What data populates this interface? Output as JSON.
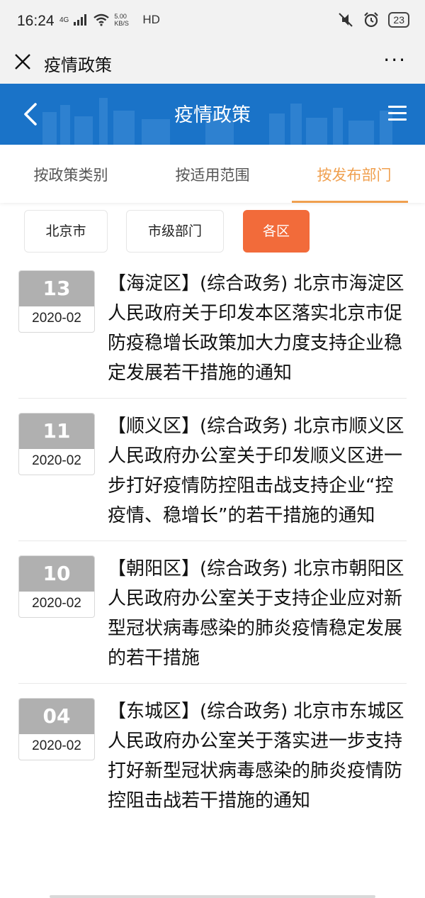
{
  "status_bar": {
    "time": "16:24",
    "network": "4G",
    "speed": "5.00 KB/S",
    "hd": "HD",
    "battery": "23"
  },
  "wechat_bar": {
    "title": "疫情政策",
    "more": "···"
  },
  "header": {
    "title": "疫情政策"
  },
  "tabs": [
    {
      "label": "按政策类别",
      "active": false
    },
    {
      "label": "按适用范围",
      "active": false
    },
    {
      "label": "按发布部门",
      "active": true
    }
  ],
  "filters": [
    {
      "label": "北京市",
      "active": false
    },
    {
      "label": "市级部门",
      "active": false
    },
    {
      "label": "各区",
      "active": true
    }
  ],
  "items": [
    {
      "day": "13",
      "year_month": "2020-02",
      "title": "【海淀区】(综合政务) 北京市海淀区人民政府关于印发本区落实北京市促防疫稳增长政策加大力度支持企业稳定发展若干措施的通知"
    },
    {
      "day": "11",
      "year_month": "2020-02",
      "title": "【顺义区】(综合政务) 北京市顺义区人民政府办公室关于印发顺义区进一步打好疫情防控阻击战支持企业“控疫情、稳增长”的若干措施的通知"
    },
    {
      "day": "10",
      "year_month": "2020-02",
      "title": "【朝阳区】(综合政务) 北京市朝阳区人民政府办公室关于支持企业应对新型冠状病毒感染的肺炎疫情稳定发展的若干措施"
    },
    {
      "day": "04",
      "year_month": "2020-02",
      "title": "【东城区】(综合政务) 北京市东城区人民政府办公室关于落实进一步支持打好新型冠状病毒感染的肺炎疫情防控阻击战若干措施的通知"
    }
  ],
  "colors": {
    "header_blue": "#1a73c8",
    "accent_orange": "#f0a04f",
    "chip_active": "#f26b3a",
    "date_gray": "#b0b0b0"
  }
}
